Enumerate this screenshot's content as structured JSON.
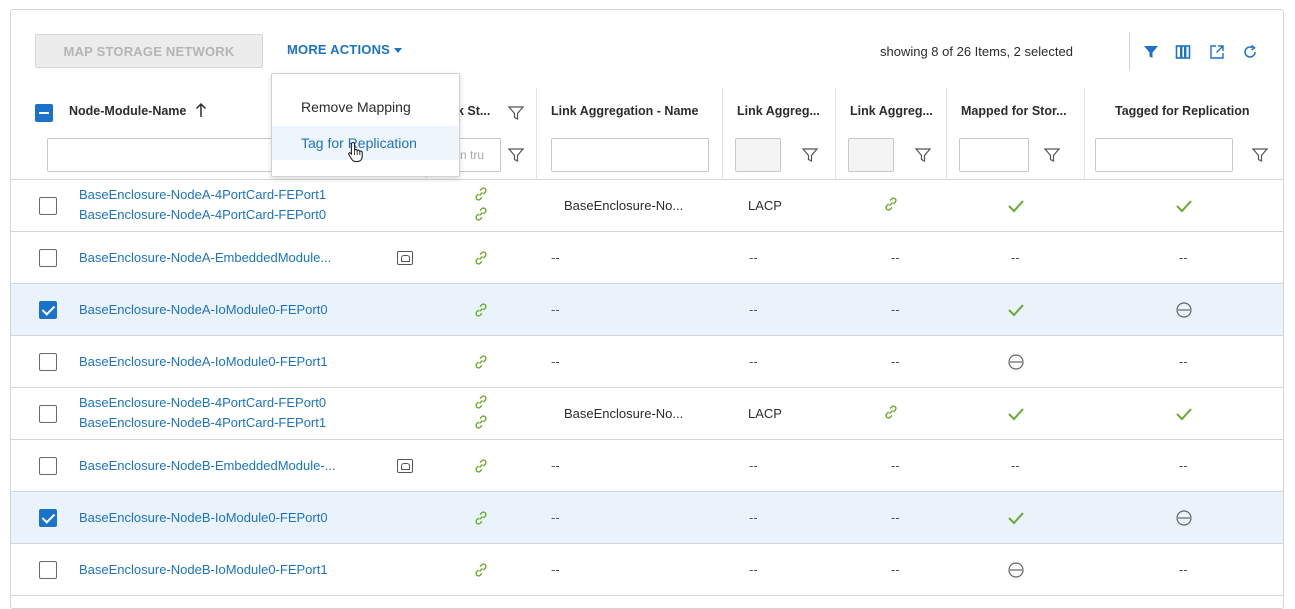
{
  "toolbar": {
    "map_storage_network_label": "MAP STORAGE NETWORK",
    "more_actions_label": "MORE ACTIONS",
    "showing_text": "showing 8 of 26 Items, 2 selected"
  },
  "dropdown": {
    "items": [
      "Remove Mapping",
      "Tag for Replication"
    ],
    "hovered": "Tag for Replication"
  },
  "columns": {
    "name": "Node-Module-Name",
    "link_status": "k St...",
    "link_status_filter_placeholder": "n tru",
    "la_name": "Link Aggregation - Name",
    "la_2": "Link Aggreg...",
    "la_3": "Link Aggreg...",
    "mapped": "Mapped for Stor...",
    "tagged": "Tagged for Replication"
  },
  "rows": [
    {
      "names": [
        "BaseEnclosure-NodeA-4PortCard-FEPort1",
        "BaseEnclosure-NodeA-4PortCard-FEPort0"
      ],
      "selected": false,
      "la_name": "BaseEnclosure-No...",
      "la_mode": "LACP",
      "la3": "link",
      "mapped": "check",
      "tagged": "check"
    },
    {
      "names": [
        "BaseEnclosure-NodeA-EmbeddedModule..."
      ],
      "selected": false,
      "embedded": true,
      "la_name": "--",
      "la_mode": "--",
      "la3": "--",
      "mapped": "--",
      "tagged": "--"
    },
    {
      "names": [
        "BaseEnclosure-NodeA-IoModule0-FEPort0"
      ],
      "selected": true,
      "la_name": "--",
      "la_mode": "--",
      "la3": "--",
      "mapped": "check",
      "tagged": "minus"
    },
    {
      "names": [
        "BaseEnclosure-NodeA-IoModule0-FEPort1"
      ],
      "selected": false,
      "la_name": "--",
      "la_mode": "--",
      "la3": "--",
      "mapped": "minus",
      "tagged": "--"
    },
    {
      "names": [
        "BaseEnclosure-NodeB-4PortCard-FEPort0",
        "BaseEnclosure-NodeB-4PortCard-FEPort1"
      ],
      "selected": false,
      "la_name": "BaseEnclosure-No...",
      "la_mode": "LACP",
      "la3": "link",
      "mapped": "check",
      "tagged": "check"
    },
    {
      "names": [
        "BaseEnclosure-NodeB-EmbeddedModule-..."
      ],
      "selected": false,
      "embedded": true,
      "la_name": "--",
      "la_mode": "--",
      "la3": "--",
      "mapped": "--",
      "tagged": "--"
    },
    {
      "names": [
        "BaseEnclosure-NodeB-IoModule0-FEPort0"
      ],
      "selected": true,
      "la_name": "--",
      "la_mode": "--",
      "la3": "--",
      "mapped": "check",
      "tagged": "minus"
    },
    {
      "names": [
        "BaseEnclosure-NodeB-IoModule0-FEPort1"
      ],
      "selected": false,
      "la_name": "--",
      "la_mode": "--",
      "la3": "--",
      "mapped": "minus",
      "tagged": "--"
    }
  ],
  "icons": {
    "filter_active": "filter-filled-icon",
    "columns": "columns-icon",
    "export": "export-icon",
    "refresh": "refresh-icon",
    "link": "link-icon",
    "check": "check-icon",
    "minus": "circle-minus-icon",
    "embedded": "embedded-port-icon"
  },
  "colors": {
    "accent": "#1a73c8",
    "success": "#6aab2a",
    "selected_row": "#eaf3fb"
  }
}
